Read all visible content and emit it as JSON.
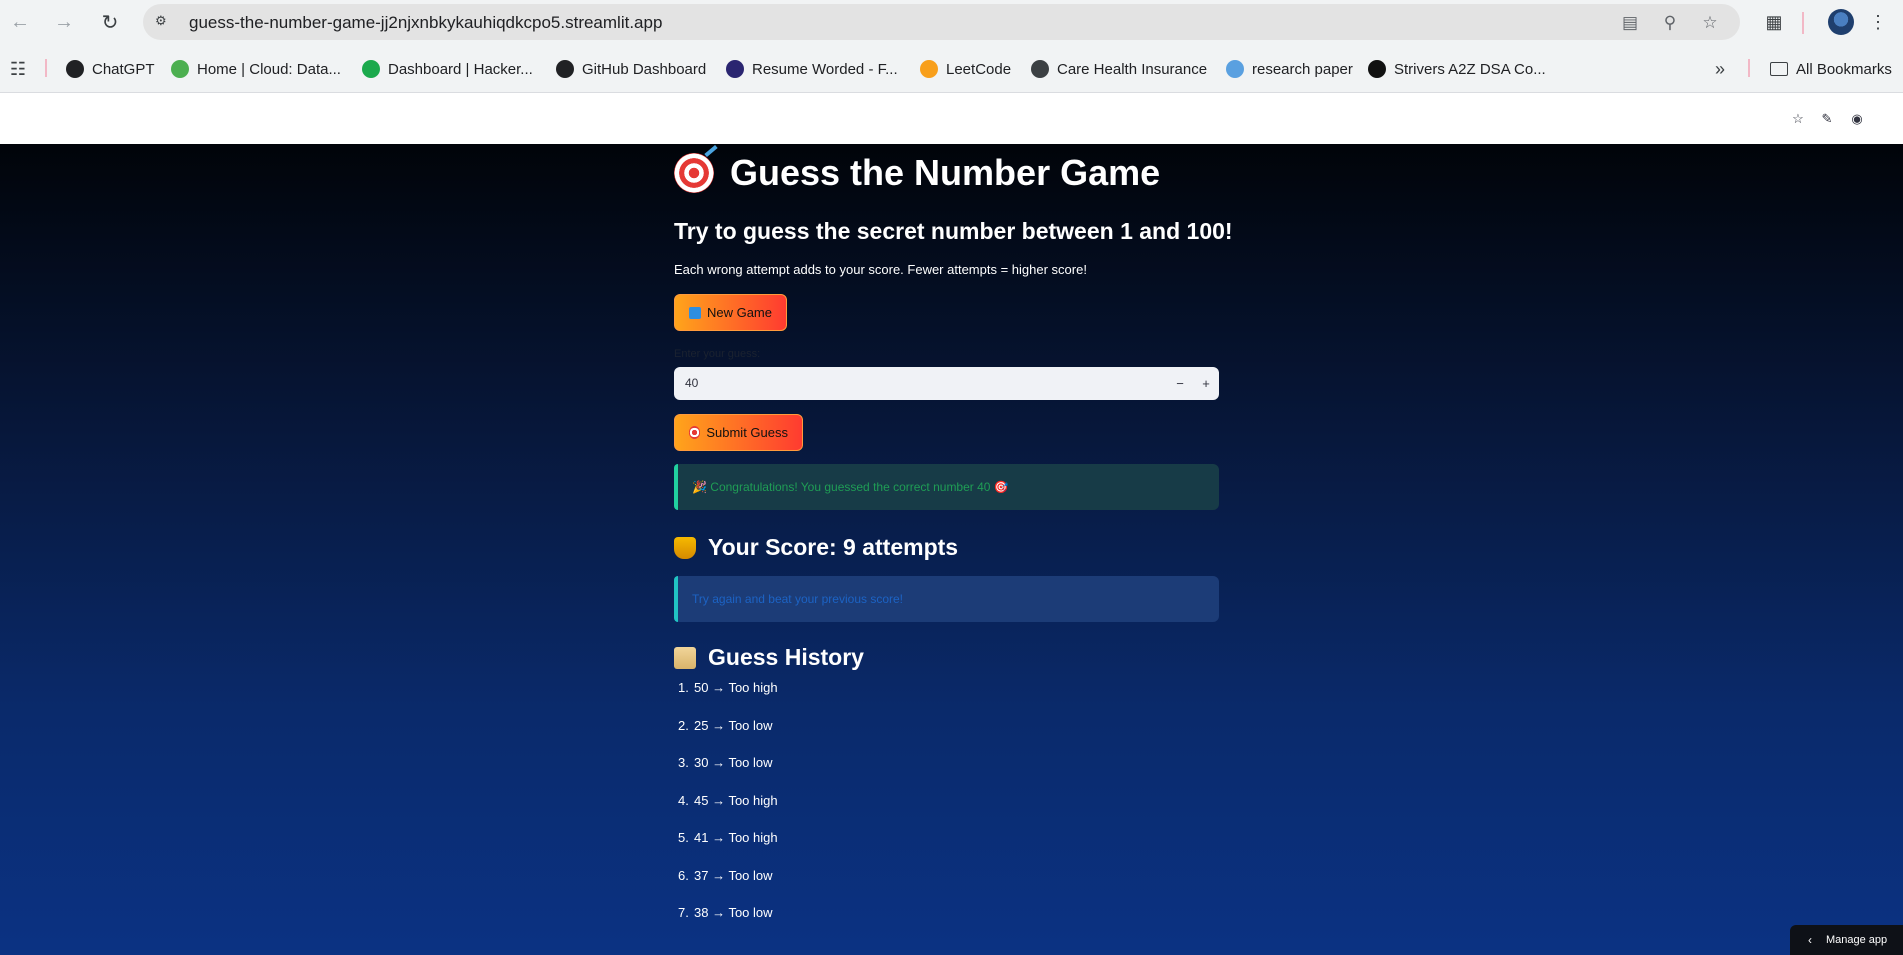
{
  "browser": {
    "url": "guess-the-number-game-jj2njxnbkykauhiqdkcpo5.streamlit.app",
    "bookmarks": [
      {
        "label": "ChatGPT",
        "icon": "chatgpt-icon",
        "color": "#202124"
      },
      {
        "label": "Home | Cloud: Data...",
        "icon": "cloud-icon",
        "color": "#4caf50"
      },
      {
        "label": "Dashboard | Hacker...",
        "icon": "hackerrank-icon",
        "color": "#1ba94c"
      },
      {
        "label": "GitHub Dashboard",
        "icon": "github-icon",
        "color": "#202124"
      },
      {
        "label": "Resume Worded - F...",
        "icon": "resume-worded-icon",
        "color": "#2a2570"
      },
      {
        "label": "LeetCode",
        "icon": "leetcode-icon",
        "color": "#f89f1b"
      },
      {
        "label": "Care Health Insurance",
        "icon": "globe-icon",
        "color": "#3c4043"
      },
      {
        "label": "research paper",
        "icon": "research-icon",
        "color": "#5aa0e0"
      },
      {
        "label": "Strivers A2Z DSA Co...",
        "icon": "tuf-icon",
        "color": "#111111"
      }
    ],
    "all_bookmarks": "All Bookmarks"
  },
  "app": {
    "title": "Guess the Number Game",
    "subtitle": "Try to guess the secret number between 1 and 100!",
    "description": "Each wrong attempt adds to your score. Fewer attempts = higher score!",
    "new_game_label": "New Game",
    "input_label": "Enter your guess:",
    "input_value": "40",
    "submit_label": "Submit Guess",
    "success_message": "🎉 Congratulations! You guessed the correct number 40 🎯",
    "score_heading": "Your Score: 9 attempts",
    "info_message": "Try again and beat your previous score!",
    "history_heading": "Guess History",
    "history": [
      {
        "n": "1.",
        "text": "50 → Too high"
      },
      {
        "n": "2.",
        "text": "25 → Too low"
      },
      {
        "n": "3.",
        "text": "30 → Too low"
      },
      {
        "n": "4.",
        "text": "45 → Too high"
      },
      {
        "n": "5.",
        "text": "41 → Too high"
      },
      {
        "n": "6.",
        "text": "37 → Too low"
      },
      {
        "n": "7.",
        "text": "38 → Too low"
      }
    ],
    "manage_app": "Manage app"
  }
}
